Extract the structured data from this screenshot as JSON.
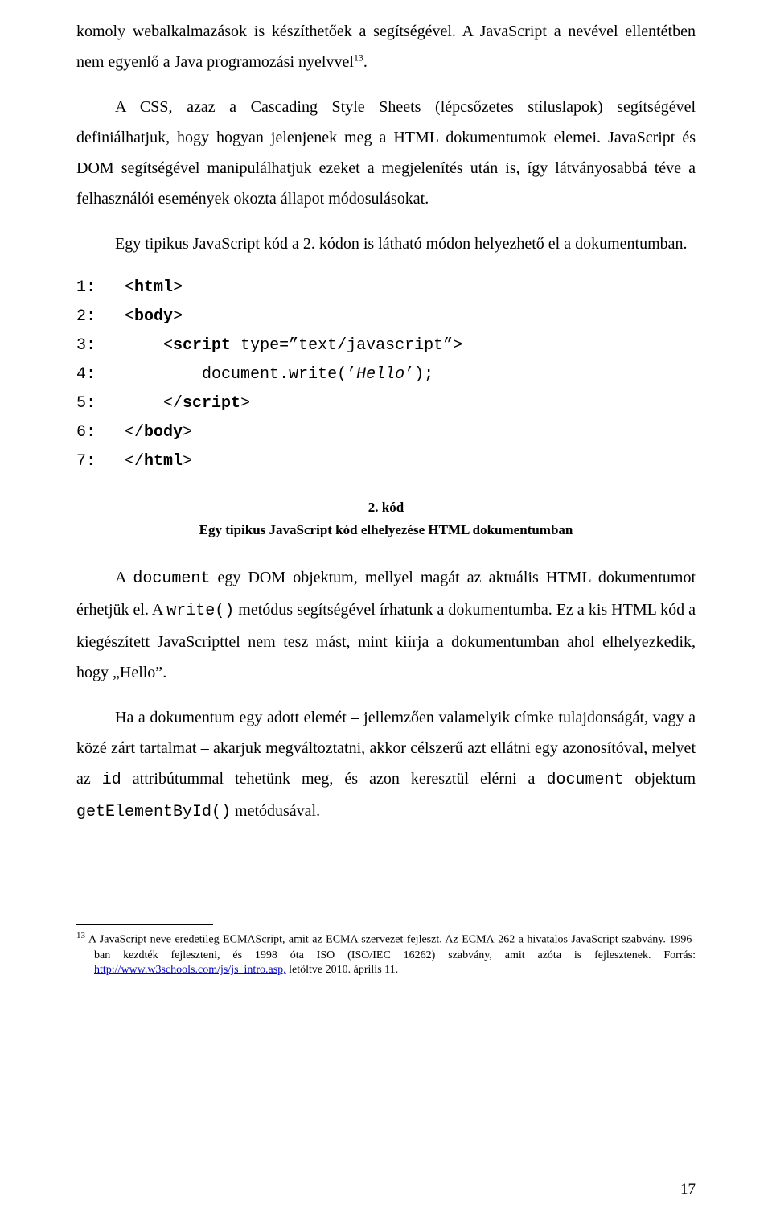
{
  "paragraphs": {
    "p1_a": "komoly webalkalmazások is készíthetőek a segítségével. A JavaScript a nevével ellentétben nem egyenlő a Java programozási nyelvvel",
    "p1_b": ".",
    "p2": "A CSS, azaz a Cascading Style Sheets (lépcsőzetes stíluslapok) segítségével definiálhatjuk, hogy hogyan jelenjenek meg a HTML dokumentumok elemei. JavaScript és DOM segítségével manipulálhatjuk ezeket a megjelenítés után is, így látványosabbá téve a felhasználói események okozta állapot módosulásokat.",
    "p3": "Egy tipikus JavaScript kód a 2. kódon is látható módon helyezhető el a dokumentumban.",
    "p4_a": "A ",
    "p4_b": "document",
    "p4_c": " egy DOM objektum, mellyel magát az aktuális HTML dokumentumot érhetjük el. A ",
    "p4_d": "write()",
    "p4_e": " metódus segítségével írhatunk a dokumentumba. Ez a kis HTML kód a kiegészített JavaScripttel nem tesz mást, mint kiírja a dokumentumban ahol elhelyezkedik, hogy „Hello”.",
    "p5_a": "Ha a dokumentum egy adott elemét – jellemzően valamelyik címke tulajdonságát, vagy a közé zárt tartalmat – akarjuk megváltoztatni, akkor célszerű azt ellátni egy azonosítóval, melyet az ",
    "p5_b": "id",
    "p5_c": " attribútummal tehetünk meg, és azon keresztül elérni a ",
    "p5_d": "document",
    "p5_e": " objektum ",
    "p5_f": "getElementById()",
    "p5_g": " metódusával."
  },
  "fnref": "13",
  "code": {
    "l1_n": "1:",
    "l1_a": "<",
    "l1_b": "html",
    "l1_c": ">",
    "l2_n": "2:",
    "l2_a": "<",
    "l2_b": "body",
    "l2_c": ">",
    "l3_n": "3:",
    "l3_a": "<",
    "l3_b": "script",
    "l3_c": " type=”text/javascript”>",
    "l4_n": "4:",
    "l4_a": "document.write(’",
    "l4_b": "Hello",
    "l4_c": "’);",
    "l5_n": "5:",
    "l5_a": "</",
    "l5_b": "script",
    "l5_c": ">",
    "l6_n": "6:",
    "l6_a": "</",
    "l6_b": "body",
    "l6_c": ">",
    "l7_n": "7:",
    "l7_a": "</",
    "l7_b": "html",
    "l7_c": ">"
  },
  "caption": {
    "title": "2. kód",
    "text": "Egy tipikus JavaScript kód elhelyezése HTML dokumentumban"
  },
  "footnote": {
    "num": "13",
    "text_a": "A JavaScript neve eredetileg ECMAScript, amit az ECMA szervezet fejleszt. Az ECMA-262 a hivatalos JavaScript szabvány. 1996-ban kezdték fejleszteni, és 1998 óta ISO (ISO/IEC 16262) szabvány, amit azóta is fejlesztenek. Forrás: ",
    "link_text": "http://www.w3schools.com/js/js_intro.asp,",
    "link_href": "http://www.w3schools.com/js/js_intro.asp",
    "text_b": " letöltve 2010. április 11."
  },
  "page_number": "17"
}
